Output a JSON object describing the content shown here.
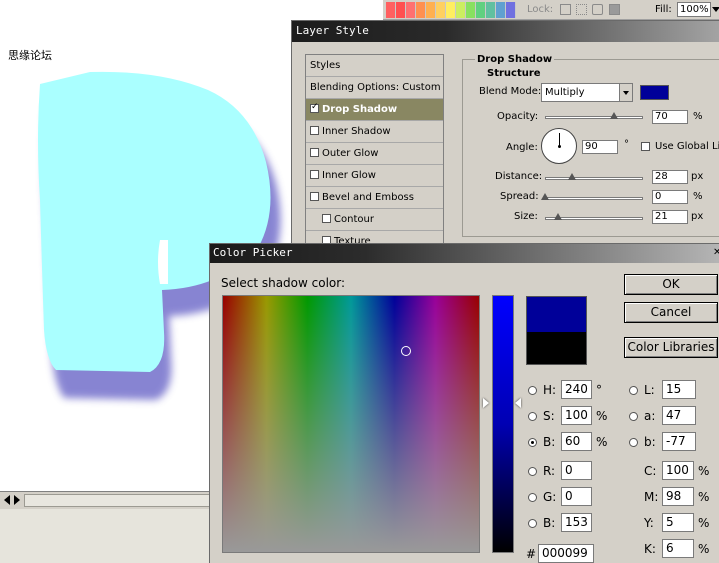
{
  "toolbar": {
    "lock_label": "Lock:",
    "fill_label": "Fill:",
    "fill_value": "100%",
    "swatches": [
      "#ff6060",
      "#ff5050",
      "#ff7070",
      "#ff9050",
      "#ffb050",
      "#ffd060",
      "#ffee60",
      "#ccee60",
      "#88e060",
      "#60d080",
      "#60c0a0",
      "#60a0d0",
      "#7070e0"
    ]
  },
  "layer_style": {
    "title": "Layer Style",
    "list_items": [
      {
        "label": "Styles",
        "checkbox": false,
        "checked": false,
        "selected": false
      },
      {
        "label": "Blending Options: Custom",
        "checkbox": false,
        "checked": false,
        "selected": false
      },
      {
        "label": "Drop Shadow",
        "checkbox": true,
        "checked": true,
        "selected": true
      },
      {
        "label": "Inner Shadow",
        "checkbox": true,
        "checked": false,
        "selected": false
      },
      {
        "label": "Outer Glow",
        "checkbox": true,
        "checked": false,
        "selected": false
      },
      {
        "label": "Inner Glow",
        "checkbox": true,
        "checked": false,
        "selected": false
      },
      {
        "label": "Bevel and Emboss",
        "checkbox": true,
        "checked": false,
        "selected": false
      },
      {
        "label": "Contour",
        "checkbox": true,
        "checked": false,
        "selected": false
      },
      {
        "label": "Texture",
        "checkbox": true,
        "checked": false,
        "selected": false
      }
    ],
    "section_title": "Drop Shadow",
    "subsection_title": "Structure",
    "blend_mode_label": "Blend Mode:",
    "blend_mode_value": "Multiply",
    "shadow_color": "#000099",
    "opacity_label": "Opacity:",
    "opacity_value": "70",
    "opacity_unit": "%",
    "opacity_level": 0.7,
    "angle_label": "Angle:",
    "angle_value": "90",
    "angle_unit": "°",
    "global_light_label": "Use Global Light",
    "distance_label": "Distance:",
    "distance_value": "28",
    "distance_unit": "px",
    "spread_label": "Spread:",
    "spread_value": "0",
    "spread_unit": "%",
    "size_label": "Size:",
    "size_value": "21",
    "size_unit": "px"
  },
  "color_picker": {
    "title": "Color Picker",
    "prompt": "Select shadow color:",
    "ok_label": "OK",
    "cancel_label": "Cancel",
    "libraries_label": "Color Libraries",
    "new_color": "#000099",
    "current_color": "#000000",
    "fields": [
      {
        "key": "H",
        "label": "H:",
        "value": "240",
        "unit": "°",
        "radio": true,
        "selected": false
      },
      {
        "key": "S",
        "label": "S:",
        "value": "100",
        "unit": "%",
        "radio": true,
        "selected": false
      },
      {
        "key": "B",
        "label": "B:",
        "value": "60",
        "unit": "%",
        "radio": true,
        "selected": true
      },
      {
        "key": "R",
        "label": "R:",
        "value": "0",
        "unit": "",
        "radio": true,
        "selected": false
      },
      {
        "key": "G",
        "label": "G:",
        "value": "0",
        "unit": "",
        "radio": true,
        "selected": false
      },
      {
        "key": "Bl",
        "label": "B:",
        "value": "153",
        "unit": "",
        "radio": true,
        "selected": false
      }
    ],
    "lab_fields": [
      {
        "label": "L:",
        "value": "15"
      },
      {
        "label": "a:",
        "value": "47"
      },
      {
        "label": "b:",
        "value": "-77"
      }
    ],
    "cmyk_fields": [
      {
        "label": "C:",
        "value": "100",
        "unit": "%"
      },
      {
        "label": "M:",
        "value": "98",
        "unit": "%"
      },
      {
        "label": "Y:",
        "value": "5",
        "unit": "%"
      },
      {
        "label": "K:",
        "value": "6",
        "unit": "%"
      }
    ],
    "hex_label": "#",
    "hex_value": "000099"
  },
  "status": {
    "text": "思缘论坛"
  }
}
